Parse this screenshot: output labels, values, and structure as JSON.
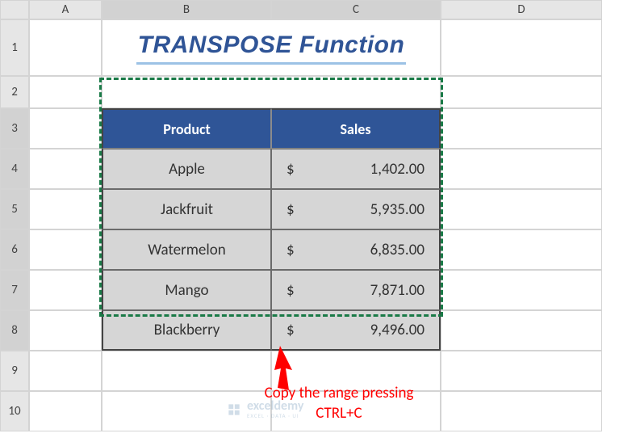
{
  "columns": [
    "A",
    "B",
    "C",
    "D"
  ],
  "rows": [
    "1",
    "2",
    "3",
    "4",
    "5",
    "6",
    "7",
    "8",
    "9",
    "10"
  ],
  "title": "TRANSPOSE Function",
  "table": {
    "headers": {
      "product": "Product",
      "sales": "Sales"
    },
    "rows": [
      {
        "product": "Apple",
        "currency": "$",
        "sales": "1,402.00"
      },
      {
        "product": "Jackfruit",
        "currency": "$",
        "sales": "5,935.00"
      },
      {
        "product": "Watermelon",
        "currency": "$",
        "sales": "6,835.00"
      },
      {
        "product": "Mango",
        "currency": "$",
        "sales": "7,871.00"
      },
      {
        "product": "Blackberry",
        "currency": "$",
        "sales": "9,496.00"
      }
    ]
  },
  "annotation": {
    "line1": "Copy the range pressing",
    "line2": "CTRL+C"
  },
  "watermark": {
    "main": "exceldemy",
    "sub": "EXCEL · DATA · UI"
  }
}
